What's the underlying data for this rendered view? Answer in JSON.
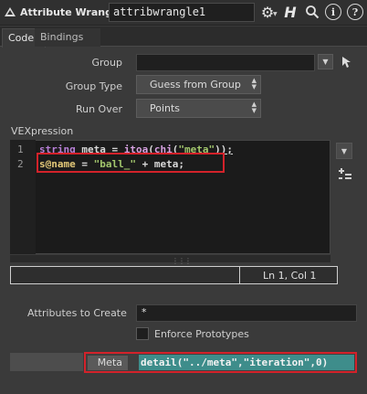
{
  "header": {
    "node_type": "Attribute Wrangle",
    "node_name": "attribwrangle1",
    "icons": [
      "node-icon",
      "gear-icon",
      "help-h-icon",
      "search-icon",
      "info-icon",
      "help-icon"
    ]
  },
  "tabs": [
    {
      "label": "Code",
      "active": true
    },
    {
      "label": "Bindings",
      "active": false
    }
  ],
  "params": {
    "group_label": "Group",
    "group_value": "",
    "group_type_label": "Group Type",
    "group_type_value": "Guess from Group",
    "run_over_label": "Run Over",
    "run_over_value": "Points"
  },
  "vex": {
    "label": "VEXpression",
    "line_numbers": [
      "1",
      "2"
    ],
    "line1": {
      "t1": "string",
      "t2": " meta = ",
      "t3": "itoa",
      "t4": "(",
      "t5": "chi",
      "t6": "(",
      "t7": "\"meta\"",
      "t8": "));"
    },
    "line2": {
      "t1": "s@name",
      "t2": " = ",
      "t3": "\"ball_\"",
      "t4": " + meta;"
    },
    "cursor_position": "Ln 1, Col 1"
  },
  "attributes": {
    "label": "Attributes to Create",
    "value": "*",
    "enforce_label": "Enforce Prototypes",
    "enforce_checked": false
  },
  "meta": {
    "label": "Meta",
    "expression": "detail(\"../meta\",\"iteration\",0)"
  },
  "colors": {
    "highlight": "#d3222a",
    "expression_bg": "#3e8d8b",
    "keyword": "#b67fd6",
    "string": "#a3c76d"
  }
}
